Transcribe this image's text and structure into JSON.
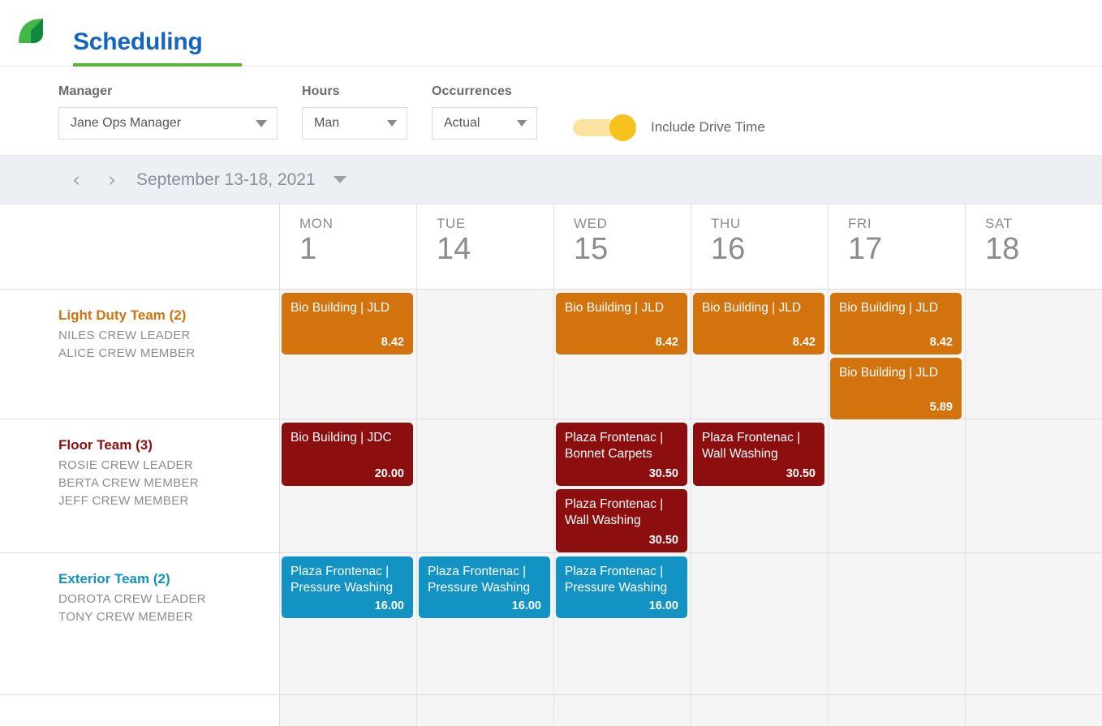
{
  "header": {
    "logo_icon": "leaf-logo-icon",
    "logo_colors": {
      "light": "#43b649",
      "dark": "#0f8a3c"
    },
    "title": "Scheduling",
    "title_color": "#1565c0",
    "underline_color": "#5cb531"
  },
  "filters": {
    "manager": {
      "label": "Manager",
      "value": "Jane Ops Manager"
    },
    "hours": {
      "label": "Hours",
      "value": "Man"
    },
    "occurrences": {
      "label": "Occurrences",
      "value": "Actual"
    },
    "drive_time": {
      "label": "Include Drive Time",
      "state": "on",
      "color": "#f7c21b"
    }
  },
  "date_nav": {
    "prev_icon": "chevron-left-icon",
    "next_icon": "chevron-right-icon",
    "range": "September 13-18, 2021",
    "dropdown_icon": "chevron-down-icon"
  },
  "calendar": {
    "days": [
      {
        "dow": "MON",
        "num": "1"
      },
      {
        "dow": "TUE",
        "num": "14"
      },
      {
        "dow": "WED",
        "num": "15"
      },
      {
        "dow": "THU",
        "num": "16"
      },
      {
        "dow": "FRI",
        "num": "17"
      },
      {
        "dow": "SAT",
        "num": "18"
      }
    ],
    "teams": [
      {
        "name": "Light Duty Team (2)",
        "color": "#d2730d",
        "members": [
          "NILES CREW LEADER",
          "ALICE CREW MEMBER"
        ],
        "events": [
          [
            {
              "title": "Bio Building | JLD",
              "value": "8.42"
            }
          ],
          [],
          [
            {
              "title": "Bio Building | JLD",
              "value": "8.42"
            }
          ],
          [
            {
              "title": "Bio Building | JLD",
              "value": "8.42"
            }
          ],
          [
            {
              "title": "Bio Building | JLD",
              "value": "8.42"
            },
            {
              "title": "Bio Building | JLD",
              "value": "5.89"
            }
          ],
          []
        ]
      },
      {
        "name": "Floor Team (3)",
        "color": "#8c0e0e",
        "members": [
          "ROSIE CREW LEADER",
          "BERTA CREW MEMBER",
          "JEFF CREW MEMBER"
        ],
        "events": [
          [
            {
              "title": "Bio Building | JDC",
              "value": "20.00"
            }
          ],
          [],
          [
            {
              "title": "Plaza Frontenac | Bonnet Carpets",
              "value": "30.50"
            },
            {
              "title": "Plaza Frontenac | Wall Washing",
              "value": "30.50"
            }
          ],
          [
            {
              "title": "Plaza Frontenac | Wall Washing",
              "value": "30.50"
            }
          ],
          [],
          []
        ]
      },
      {
        "name": "Exterior Team (2)",
        "color": "#1293c4",
        "members": [
          "DOROTA CREW LEADER",
          "TONY CREW MEMBER"
        ],
        "events": [
          [
            {
              "title": "Plaza Frontenac | Pressure Washing",
              "value": "16.00"
            }
          ],
          [
            {
              "title": "Plaza Frontenac | Pressure Washing",
              "value": "16.00"
            }
          ],
          [
            {
              "title": "Plaza Frontenac | Pressure Washing",
              "value": "16.00"
            }
          ],
          [],
          [],
          []
        ]
      }
    ]
  }
}
